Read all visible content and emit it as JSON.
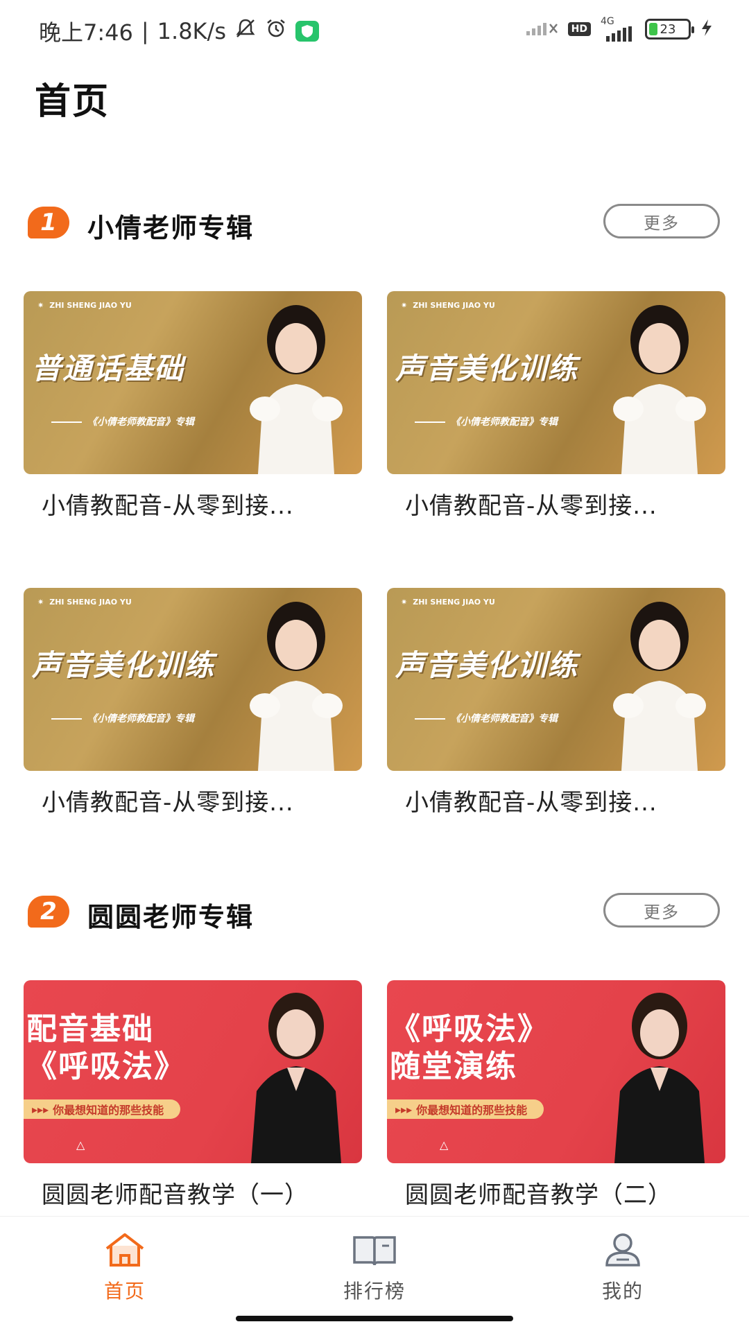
{
  "status_bar": {
    "time": "晚上7:46",
    "speed": "1.8K/s",
    "network": "4G",
    "hd": "HD",
    "battery": "23"
  },
  "page_title": "首页",
  "sections": [
    {
      "number": "1",
      "title": "小倩老师专辑",
      "more_label": "更多",
      "cards": [
        {
          "thumb_brand": "ZHI SHENG JIAO YU",
          "thumb_title": "普通话基础",
          "thumb_sub": "《小倩老师教配音》专辑",
          "caption": "小倩教配音-从零到接..."
        },
        {
          "thumb_brand": "ZHI SHENG JIAO YU",
          "thumb_title": "声音美化训练",
          "thumb_sub": "《小倩老师教配音》专辑",
          "caption": "小倩教配音-从零到接..."
        },
        {
          "thumb_brand": "ZHI SHENG JIAO YU",
          "thumb_title": "声音美化训练",
          "thumb_sub": "《小倩老师教配音》专辑",
          "caption": "小倩教配音-从零到接..."
        },
        {
          "thumb_brand": "ZHI SHENG JIAO YU",
          "thumb_title": "声音美化训练",
          "thumb_sub": "《小倩老师教配音》专辑",
          "caption": "小倩教配音-从零到接..."
        }
      ]
    },
    {
      "number": "2",
      "title": "圆圆老师专辑",
      "more_label": "更多",
      "cards": [
        {
          "thumb_line1": "配音基础",
          "thumb_line2": "《呼吸法》",
          "thumb_tag": "你最想知道的那些技能",
          "caption": "圆圆老师配音教学（一）"
        },
        {
          "thumb_line1": "《呼吸法》",
          "thumb_line2": "随堂演练",
          "thumb_tag": "你最想知道的那些技能",
          "caption": "圆圆老师配音教学（二）"
        }
      ]
    }
  ],
  "tab_bar": {
    "tabs": [
      {
        "label": "首页",
        "icon": "home-icon",
        "active": true
      },
      {
        "label": "排行榜",
        "icon": "book-icon",
        "active": false
      },
      {
        "label": "我的",
        "icon": "user-icon",
        "active": false
      }
    ]
  },
  "colors": {
    "accent": "#f26a1b",
    "gold_thumb": "#c7a35c",
    "red_thumb": "#e4424a"
  }
}
